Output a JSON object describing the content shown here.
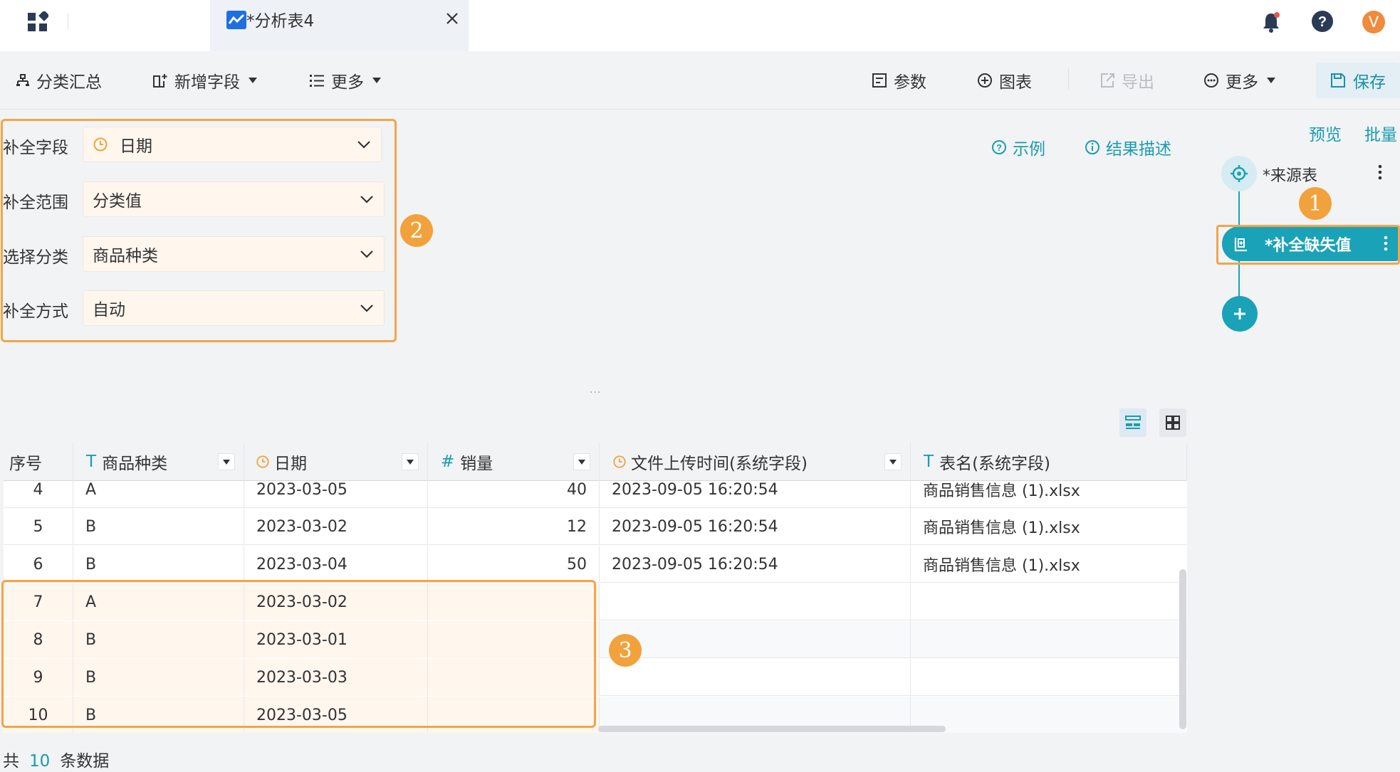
{
  "app": {
    "tab_title": "*分析表4",
    "avatar_letter": "V"
  },
  "toolbar": {
    "group_summary": "分类汇总",
    "add_field": "新增字段",
    "more_left": "更多",
    "params": "参数",
    "chart": "图表",
    "export": "导出",
    "more_right": "更多",
    "save": "保存"
  },
  "config": {
    "fill_field_label": "补全字段",
    "fill_field_value": "日期",
    "fill_range_label": "补全范围",
    "fill_range_value": "分类值",
    "select_category_label": "选择分类",
    "select_category_value": "商品种类",
    "fill_method_label": "补全方式",
    "fill_method_value": "自动"
  },
  "links": {
    "example": "示例",
    "result_desc": "结果描述"
  },
  "badges": {
    "one": "1",
    "two": "2",
    "three": "3"
  },
  "splitter": "...",
  "table": {
    "headers": [
      "序号",
      "商品种类",
      "日期",
      "销量",
      "文件上传时间(系统字段)",
      "表名(系统字段)"
    ],
    "header_type_icons": [
      "",
      "T",
      "clock",
      "#",
      "clock",
      "T"
    ],
    "rows": [
      [
        "4",
        "A",
        "2023-03-05",
        "40",
        "2023-09-05 16:20:54",
        "商品销售信息 (1).xlsx"
      ],
      [
        "5",
        "B",
        "2023-03-02",
        "12",
        "2023-09-05 16:20:54",
        "商品销售信息 (1).xlsx"
      ],
      [
        "6",
        "B",
        "2023-03-04",
        "50",
        "2023-09-05 16:20:54",
        "商品销售信息 (1).xlsx"
      ],
      [
        "7",
        "A",
        "2023-03-02",
        "",
        "",
        ""
      ],
      [
        "8",
        "B",
        "2023-03-01",
        "",
        "",
        ""
      ],
      [
        "9",
        "B",
        "2023-03-03",
        "",
        "",
        ""
      ],
      [
        "10",
        "B",
        "2023-03-05",
        "",
        "",
        ""
      ]
    ]
  },
  "footer": {
    "prefix": "共",
    "count": "10",
    "suffix": "条数据"
  },
  "flow": {
    "preview": "预览",
    "batch": "批量",
    "source_node": "*来源表",
    "fill_node": "*补全缺失值"
  },
  "colors": {
    "accent": "#1aa2b8",
    "highlight": "#f2a54a",
    "filled_row_bg": "#fff6ee"
  }
}
